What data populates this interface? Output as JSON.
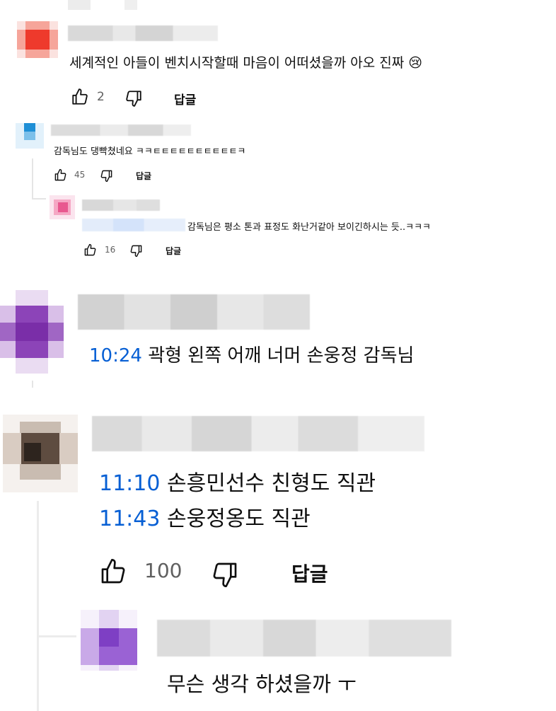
{
  "comments": [
    {
      "text": "세계적인 아들이 벤치시작할때 마음이 어떠셨을까 아오 진짜",
      "emoji": "😢",
      "likes": "2",
      "reply_label": "답글"
    },
    {
      "text": "감독님도 댕빡쳤네요 ㅋㅋㅌㅌㅌㅌㅌㅌㅌㅌㅌㅌㅋ",
      "likes": "45",
      "reply_label": "답글"
    },
    {
      "text": "감독님은 평소 톤과 표정도 화난거같아 보이긴하시는 듯..ㅋㅋㅋ",
      "likes": "16",
      "reply_label": "답글"
    },
    {
      "timestamp": "10:24",
      "text": "곽형 왼쪽 어깨 너머 손웅정 감독님"
    },
    {
      "lines": [
        {
          "timestamp": "11:10",
          "text": "손흥민선수 친형도 직관"
        },
        {
          "timestamp": "11:43",
          "text": "손웅정옹도 직관"
        }
      ],
      "likes": "100",
      "reply_label": "답글"
    },
    {
      "text": "무슨 생각 하셨을까 ㅜ"
    }
  ],
  "icons": [
    "thumb-up-icon",
    "thumb-down-icon"
  ],
  "colors": {
    "timestamp": "#065fd4",
    "text": "#0f0f0f",
    "meta": "#606060"
  }
}
